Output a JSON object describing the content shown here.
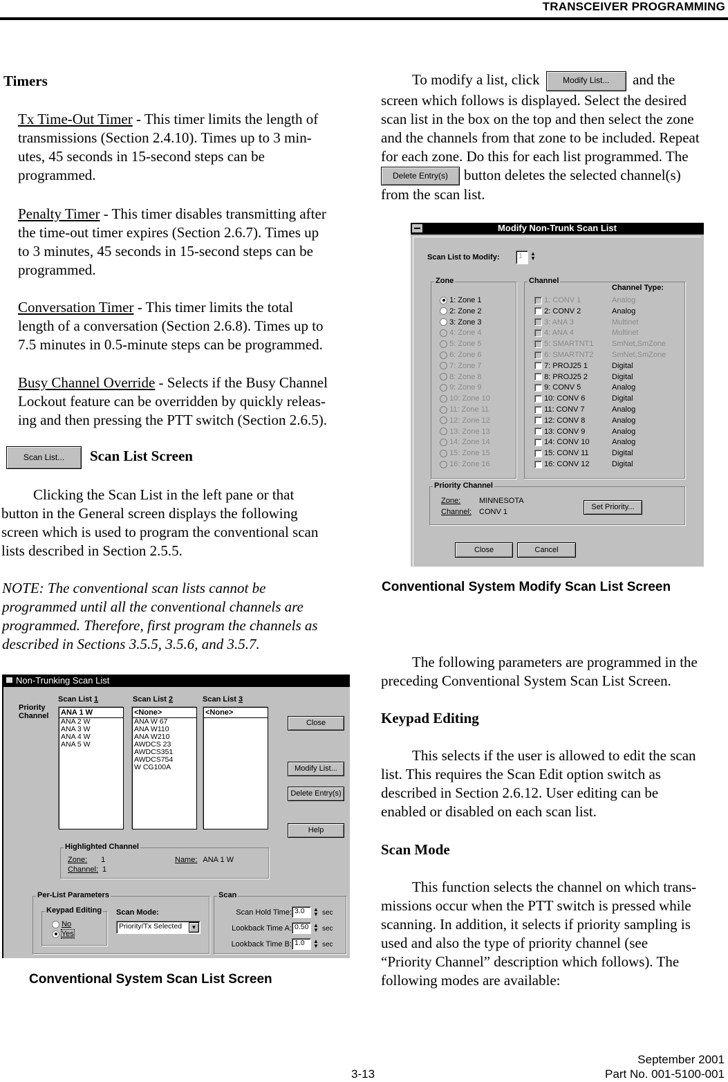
{
  "header": {
    "title": "TRANSCEIVER PROGRAMMING"
  },
  "left": {
    "timers_heading": "Timers",
    "tx_timer": {
      "term": "Tx Time-Out Timer",
      "lines": [
        " - This timer limits the length of",
        "transmissions (Section 2.4.10). Times up to 3 min-",
        "utes, 45 seconds in 15-second steps can be",
        "programmed."
      ]
    },
    "penalty_timer": {
      "term": "Penalty Timer",
      "lines": [
        " - This timer disables transmitting after",
        "the time-out timer expires (Section 2.6.7). Times up",
        "to 3 minutes, 45 seconds in 15-second steps can be",
        "programmed."
      ]
    },
    "conversation_timer": {
      "term": "Conversation Timer",
      "lines": [
        " - This timer limits the total",
        "length of a conversation (Section 2.6.8). Times up to",
        "7.5 minutes in 0.5-minute steps can be programmed."
      ]
    },
    "busy_override": {
      "term": "Busy Channel Override",
      "lines": [
        " - Selects if the Busy Channel",
        "Lockout feature can be overridden by quickly releas-",
        "ing and then pressing the PTT switch (Section 2.6.5)."
      ]
    },
    "scan_list_button": "Scan List...",
    "scan_list_heading": "Scan List Screen",
    "scan_list_para": [
      "Clicking the Scan List in the left pane or that",
      "button in the General screen displays the following",
      "screen which is used to program the conventional scan",
      "lists described in Section 2.5.5."
    ],
    "note": [
      "NOTE: The conventional scan lists cannot be",
      "programmed until all the conventional channels are",
      "programmed. Therefore, first program the channels as",
      "described in Sections 3.5.5, 3.5.6, and 3.5.7."
    ],
    "caption": "Conventional System Scan List Screen"
  },
  "scan_window": {
    "title": "Non-Trunking Scan List",
    "priority_label": [
      "Priority",
      "Channel"
    ],
    "lists": [
      {
        "label": "Scan List ",
        "num": "1",
        "priority": "ANA 1 W",
        "items": [
          "ANA 2 W",
          "ANA 3 W",
          "ANA 4 W",
          "ANA 5 W"
        ]
      },
      {
        "label": "Scan List ",
        "num": "2",
        "priority": "<None>",
        "items": [
          "ANA W 67",
          "ANA W110",
          "ANA W210",
          "AWDCS 23",
          "AWDCS351",
          "AWDCS754",
          "W CG100A"
        ]
      },
      {
        "label": "Scan List ",
        "num": "3",
        "priority": "<None>",
        "items": []
      }
    ],
    "buttons": {
      "close": "Close",
      "modify": "Modify List...",
      "delete": "Delete Entry(s)",
      "help": "Help"
    },
    "highlighted": {
      "title": "Highlighted Channel",
      "zone_label": "Zone:",
      "zone": "1",
      "channel_label": "Channel:",
      "channel": "1",
      "name_label": "Name:",
      "name": "ANA 1 W"
    },
    "per_list": {
      "title": "Per-List Parameters",
      "keypad_title": "Keypad Editing",
      "no": "No",
      "yes": "Yes",
      "selected": "Yes",
      "scan_mode_label": "Scan Mode:",
      "scan_mode_value": "Priority/Tx Selected"
    },
    "scan": {
      "title": "Scan",
      "rows": [
        {
          "label": "Scan Hold Time:",
          "value": "3.0",
          "unit": "sec"
        },
        {
          "label": "Lookback Time A:",
          "value": "0.50",
          "unit": "sec"
        },
        {
          "label": "Lookback Time B:",
          "value": "1.0",
          "unit": "sec"
        }
      ]
    }
  },
  "right": {
    "modify_para": {
      "pre": "To modify a list, click",
      "button": "Modify List...",
      "post": "and the",
      "lines": [
        "screen which follows is displayed. Select the desired",
        "scan list in the box on the top and then select the zone",
        "and the channels from that zone to be included. Repeat",
        "for each zone. Do this for each list programmed. The"
      ],
      "delete_button": "Delete Entry(s)",
      "delete_post": "button deletes the selected channel(s)",
      "last": "from the scan list."
    },
    "caption": "Conventional System Modify Scan List Screen",
    "following_para": [
      "The following parameters are programmed in the",
      "preceding Conventional System Scan List Screen."
    ],
    "keypad_heading": "Keypad Editing",
    "keypad_para": [
      "This selects if the user is allowed to edit the scan",
      "list. This requires the Scan Edit option switch as",
      "described in Section 2.6.12. User editing can be",
      "enabled or disabled on each scan list."
    ],
    "scan_mode_heading": "Scan Mode",
    "scan_mode_para": [
      "This function selects the channel on which trans-",
      "missions occur when the PTT switch is pressed while",
      "scanning. In addition, it selects if priority sampling is",
      "used and also the type of priority channel (see",
      "“Priority Channel” description which follows). The",
      "following modes are available:"
    ]
  },
  "modify_window": {
    "title": "Modify Non-Trunk Scan List",
    "scan_list_label": "Scan List to Modify:",
    "scan_list_value": "1",
    "zone_title": "Zone",
    "zones": [
      {
        "label": "1:  Zone 1",
        "enabled": true,
        "selected": true
      },
      {
        "label": "2:  Zone 2",
        "enabled": true
      },
      {
        "label": "3:  Zone 3",
        "enabled": true
      },
      {
        "label": "4:  Zone 4",
        "enabled": false
      },
      {
        "label": "5:  Zone 5",
        "enabled": false
      },
      {
        "label": "6:  Zone 6",
        "enabled": false
      },
      {
        "label": "7:  Zone 7",
        "enabled": false
      },
      {
        "label": "8:  Zone 8",
        "enabled": false
      },
      {
        "label": "9:  Zone 9",
        "enabled": false
      },
      {
        "label": "10:  Zone 10",
        "enabled": false
      },
      {
        "label": "11:  Zone 11",
        "enabled": false
      },
      {
        "label": "12:  Zone 12",
        "enabled": false
      },
      {
        "label": "13:  Zone 13",
        "enabled": false
      },
      {
        "label": "14:  Zone 14",
        "enabled": false
      },
      {
        "label": "15:  Zone 15",
        "enabled": false
      },
      {
        "label": "16:  Zone 16",
        "enabled": false
      }
    ],
    "channel_title": "Channel",
    "channel_type_title": "Channel Type:",
    "channels": [
      {
        "label": "1:  CONV 1",
        "type": "Analog",
        "enabled": false
      },
      {
        "label": "2:  CONV 2",
        "type": "Analog",
        "enabled": true
      },
      {
        "label": "3:  ANA 3",
        "type": "Multinet",
        "enabled": false
      },
      {
        "label": "4:  ANA 4",
        "type": "Multinet",
        "enabled": false
      },
      {
        "label": "5:  SMARTNT1",
        "type": "SmNet,SmZone",
        "enabled": false
      },
      {
        "label": "6:  SMARTNT2",
        "type": "SmNet,SmZone",
        "enabled": false
      },
      {
        "label": "7:  PROJ25 1",
        "type": "Digital",
        "enabled": true
      },
      {
        "label": "8:  PROJ25 2",
        "type": "Digital",
        "enabled": true
      },
      {
        "label": "9:  CONV 5",
        "type": "Analog",
        "enabled": true
      },
      {
        "label": "10:  CONV 6",
        "type": "Digital",
        "enabled": true
      },
      {
        "label": "11:  CONV 7",
        "type": "Analog",
        "enabled": true
      },
      {
        "label": "12:  CONV 8",
        "type": "Analog",
        "enabled": true
      },
      {
        "label": "13:  CONV 9",
        "type": "Analog",
        "enabled": true
      },
      {
        "label": "14:  CONV 10",
        "type": "Analog",
        "enabled": true
      },
      {
        "label": "15:  CONV 11",
        "type": "Digital",
        "enabled": true
      },
      {
        "label": "16:  CONV 12",
        "type": "Digital",
        "enabled": true
      }
    ],
    "priority": {
      "title": "Priority Channel",
      "zone_label": "Zone:",
      "zone": "MINNESOTA",
      "channel_label": "Channel:",
      "channel": "CONV 1",
      "set_button": "Set Priority..."
    },
    "buttons": {
      "close": "Close",
      "cancel": "Cancel"
    }
  },
  "footer": {
    "page": "3-13",
    "date": "September 2001",
    "part": "Part No. 001-5100-001"
  }
}
